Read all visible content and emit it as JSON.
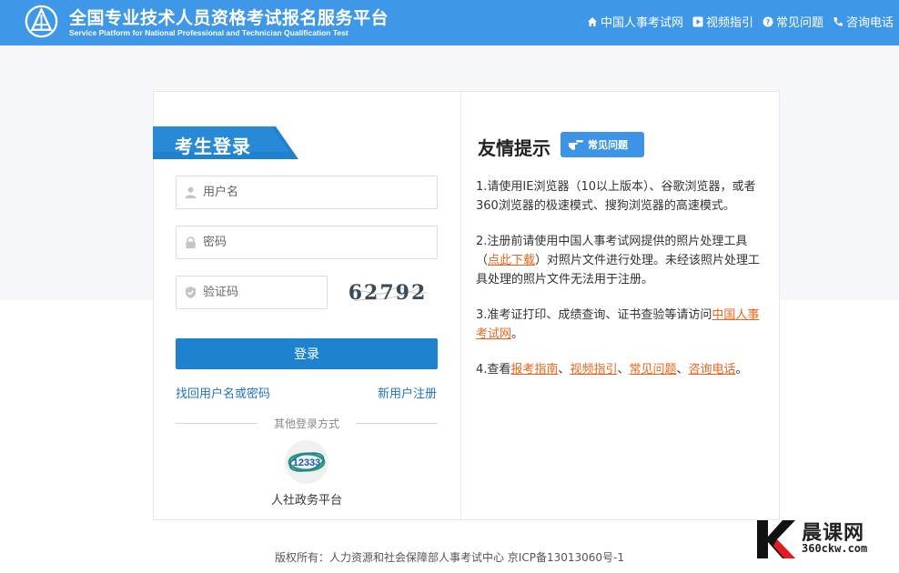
{
  "header": {
    "title_cn": "全国专业技术人员资格考试报名服务平台",
    "title_en": "Service Platform for National Professional and Technician Qualification Test",
    "nav": [
      {
        "label": "中国人事考试网",
        "icon": "home-icon"
      },
      {
        "label": "视频指引",
        "icon": "play-icon"
      },
      {
        "label": "常见问题",
        "icon": "question-icon"
      },
      {
        "label": "咨询电话",
        "icon": "phone-icon"
      }
    ]
  },
  "login": {
    "tab_label": "考生登录",
    "username_placeholder": "用户名",
    "password_placeholder": "密码",
    "captcha_placeholder": "验证码",
    "captcha_text": "62792",
    "submit_label": "登录",
    "forgot_label": "找回用户名或密码",
    "register_label": "新用户注册",
    "other_methods_label": "其他登录方式",
    "gov_platform_label": "人社政务平台",
    "gov_icon_text": "12333"
  },
  "tips": {
    "title": "友情提示",
    "faq_badge": "常见问题",
    "item1": "1.请使用IE浏览器（10以上版本）、谷歌浏览器，或者360浏览器的极速模式、搜狗浏览器的高速模式。",
    "item2_pre": "2.注册前请使用中国人事考试网提供的照片处理工具（",
    "item2_link": "点此下载",
    "item2_post": "）对照片文件进行处理。未经该照片处理工具处理的照片文件无法用于注册。",
    "item3_pre": "3.准考证打印、成绩查询、证书查验等请访问",
    "item3_link": "中国人事考试网",
    "item3_post": "。",
    "item4_pre": "4.查看",
    "item4_link1": "报考指南",
    "item4_sep1": "、",
    "item4_link2": "视频指引",
    "item4_sep2": "、",
    "item4_link3": "常见问题",
    "item4_sep3": "、",
    "item4_link4": "咨询电话",
    "item4_post": "。"
  },
  "footer": {
    "copyright": "版权所有：人力资源和社会保障部人事考试中心 京ICP备13013060号-1"
  },
  "watermark": {
    "cn": "晨课网",
    "en": "360ckw.com"
  },
  "colors": {
    "header_bg": "#3f97e8",
    "primary_button": "#1e82cf",
    "link_blue": "#1e74c4",
    "link_orange": "#e8641c"
  }
}
